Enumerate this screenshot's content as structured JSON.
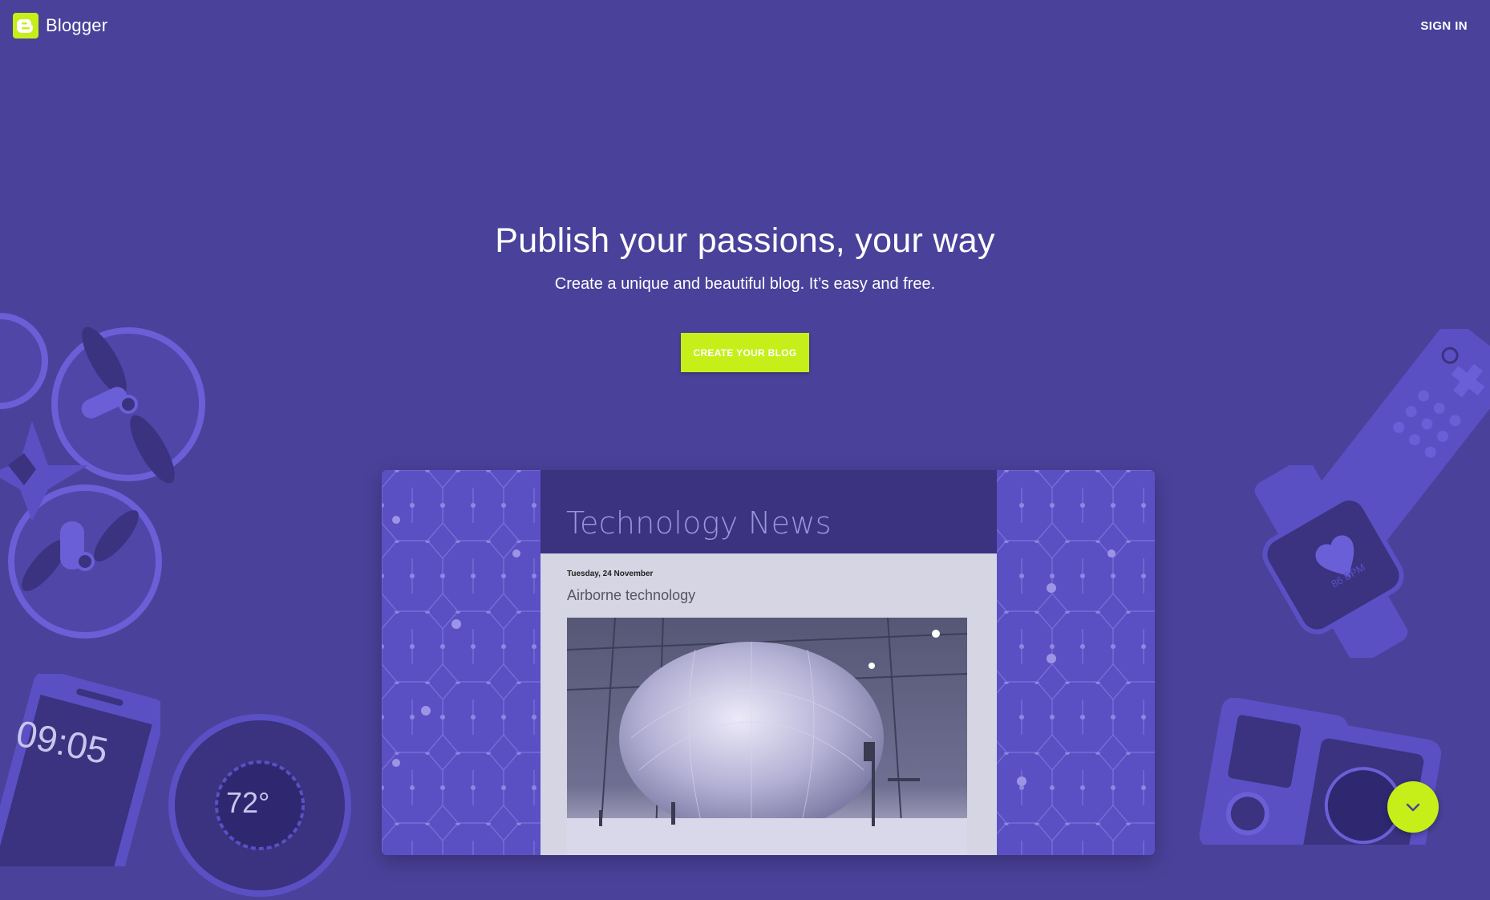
{
  "header": {
    "brand": "Blogger",
    "sign_in_label": "SIGN IN"
  },
  "hero": {
    "headline": "Publish your passions, your way",
    "subheadline": "Create a unique and beautiful blog. It’s easy and free.",
    "cta_label": "CREATE YOUR BLOG"
  },
  "mockup": {
    "blog_title": "Technology News",
    "post_date": "Tuesday, 24 November",
    "post_title": "Airborne technology"
  },
  "decorations": {
    "phone_time": "09:05",
    "thermostat_temp": "72°",
    "watch_bpm": "86 BPM"
  },
  "colors": {
    "background": "#4a419a",
    "accent": "#c6ee19"
  },
  "icons": {
    "logo": "blogger-logo-icon",
    "scroll": "chevron-down-icon"
  }
}
